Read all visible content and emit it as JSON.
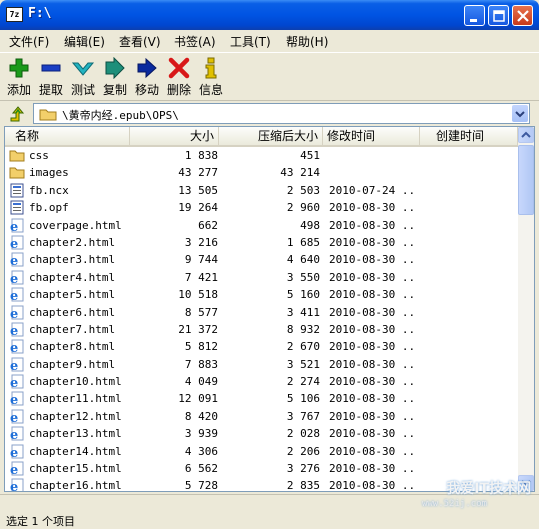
{
  "window": {
    "title": "F:\\",
    "icon_text": "7z"
  },
  "menu": [
    "文件(F)",
    "编辑(E)",
    "查看(V)",
    "书签(A)",
    "工具(T)",
    "帮助(H)"
  ],
  "toolbar": [
    {
      "label": "添加",
      "icon": "plus-icon",
      "color": "#1a9a1a"
    },
    {
      "label": "提取",
      "icon": "minus-icon",
      "color": "#1a3fc4"
    },
    {
      "label": "测试",
      "icon": "check-icon",
      "color": "#22b3c0"
    },
    {
      "label": "复制",
      "icon": "copy-arrow-icon",
      "color": "#1e8f7a"
    },
    {
      "label": "移动",
      "icon": "move-arrow-icon",
      "color": "#0a2a9e"
    },
    {
      "label": "删除",
      "icon": "delete-x-icon",
      "color": "#d81818"
    },
    {
      "label": "信息",
      "icon": "info-icon",
      "color": "#e0c000"
    }
  ],
  "address": {
    "path": "\\黄帝内经.epub\\OPS\\"
  },
  "columns": [
    "名称",
    "大小",
    "压缩后大小",
    "修改时间",
    "创建时间"
  ],
  "files": [
    {
      "name": "css",
      "size": "1 838",
      "packed": "451",
      "modified": "",
      "type": "folder"
    },
    {
      "name": "images",
      "size": "43 277",
      "packed": "43 214",
      "modified": "",
      "type": "folder"
    },
    {
      "name": "fb.ncx",
      "size": "13 505",
      "packed": "2 503",
      "modified": "2010-07-24 ..",
      "type": "doc"
    },
    {
      "name": "fb.opf",
      "size": "19 264",
      "packed": "2 960",
      "modified": "2010-08-30 ..",
      "type": "doc"
    },
    {
      "name": "coverpage.html",
      "size": "662",
      "packed": "498",
      "modified": "2010-08-30 ..",
      "type": "html"
    },
    {
      "name": "chapter2.html",
      "size": "3 216",
      "packed": "1 685",
      "modified": "2010-08-30 ..",
      "type": "html"
    },
    {
      "name": "chapter3.html",
      "size": "9 744",
      "packed": "4 640",
      "modified": "2010-08-30 ..",
      "type": "html"
    },
    {
      "name": "chapter4.html",
      "size": "7 421",
      "packed": "3 550",
      "modified": "2010-08-30 ..",
      "type": "html"
    },
    {
      "name": "chapter5.html",
      "size": "10 518",
      "packed": "5 160",
      "modified": "2010-08-30 ..",
      "type": "html"
    },
    {
      "name": "chapter6.html",
      "size": "8 577",
      "packed": "3 411",
      "modified": "2010-08-30 ..",
      "type": "html"
    },
    {
      "name": "chapter7.html",
      "size": "21 372",
      "packed": "8 932",
      "modified": "2010-08-30 ..",
      "type": "html"
    },
    {
      "name": "chapter8.html",
      "size": "5 812",
      "packed": "2 670",
      "modified": "2010-08-30 ..",
      "type": "html"
    },
    {
      "name": "chapter9.html",
      "size": "7 883",
      "packed": "3 521",
      "modified": "2010-08-30 ..",
      "type": "html"
    },
    {
      "name": "chapter10.html",
      "size": "4 049",
      "packed": "2 274",
      "modified": "2010-08-30 ..",
      "type": "html"
    },
    {
      "name": "chapter11.html",
      "size": "12 091",
      "packed": "5 106",
      "modified": "2010-08-30 ..",
      "type": "html"
    },
    {
      "name": "chapter12.html",
      "size": "8 420",
      "packed": "3 767",
      "modified": "2010-08-30 ..",
      "type": "html"
    },
    {
      "name": "chapter13.html",
      "size": "3 939",
      "packed": "2 028",
      "modified": "2010-08-30 ..",
      "type": "html"
    },
    {
      "name": "chapter14.html",
      "size": "4 306",
      "packed": "2 206",
      "modified": "2010-08-30 ..",
      "type": "html"
    },
    {
      "name": "chapter15.html",
      "size": "6 562",
      "packed": "3 276",
      "modified": "2010-08-30 ..",
      "type": "html"
    },
    {
      "name": "chapter16.html",
      "size": "5 728",
      "packed": "2 835",
      "modified": "2010-08-30 ..",
      "type": "html"
    }
  ],
  "status": {
    "text": "选定 1 个项目"
  },
  "watermark": {
    "text": "我爱IT技术网",
    "url": "www.52ij.com"
  }
}
